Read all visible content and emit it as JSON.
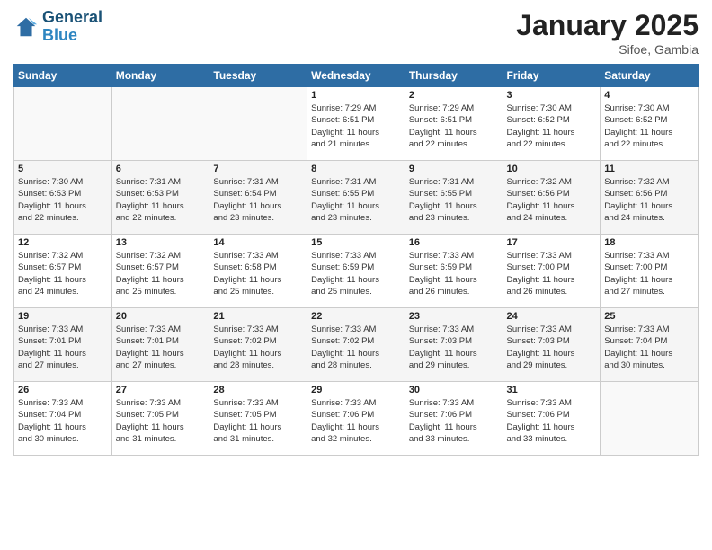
{
  "logo": {
    "line1": "General",
    "line2": "Blue"
  },
  "title": "January 2025",
  "subtitle": "Sifoe, Gambia",
  "weekdays": [
    "Sunday",
    "Monday",
    "Tuesday",
    "Wednesday",
    "Thursday",
    "Friday",
    "Saturday"
  ],
  "weeks": [
    [
      {
        "day": "",
        "info": ""
      },
      {
        "day": "",
        "info": ""
      },
      {
        "day": "",
        "info": ""
      },
      {
        "day": "1",
        "info": "Sunrise: 7:29 AM\nSunset: 6:51 PM\nDaylight: 11 hours\nand 21 minutes."
      },
      {
        "day": "2",
        "info": "Sunrise: 7:29 AM\nSunset: 6:51 PM\nDaylight: 11 hours\nand 22 minutes."
      },
      {
        "day": "3",
        "info": "Sunrise: 7:30 AM\nSunset: 6:52 PM\nDaylight: 11 hours\nand 22 minutes."
      },
      {
        "day": "4",
        "info": "Sunrise: 7:30 AM\nSunset: 6:52 PM\nDaylight: 11 hours\nand 22 minutes."
      }
    ],
    [
      {
        "day": "5",
        "info": "Sunrise: 7:30 AM\nSunset: 6:53 PM\nDaylight: 11 hours\nand 22 minutes."
      },
      {
        "day": "6",
        "info": "Sunrise: 7:31 AM\nSunset: 6:53 PM\nDaylight: 11 hours\nand 22 minutes."
      },
      {
        "day": "7",
        "info": "Sunrise: 7:31 AM\nSunset: 6:54 PM\nDaylight: 11 hours\nand 23 minutes."
      },
      {
        "day": "8",
        "info": "Sunrise: 7:31 AM\nSunset: 6:55 PM\nDaylight: 11 hours\nand 23 minutes."
      },
      {
        "day": "9",
        "info": "Sunrise: 7:31 AM\nSunset: 6:55 PM\nDaylight: 11 hours\nand 23 minutes."
      },
      {
        "day": "10",
        "info": "Sunrise: 7:32 AM\nSunset: 6:56 PM\nDaylight: 11 hours\nand 24 minutes."
      },
      {
        "day": "11",
        "info": "Sunrise: 7:32 AM\nSunset: 6:56 PM\nDaylight: 11 hours\nand 24 minutes."
      }
    ],
    [
      {
        "day": "12",
        "info": "Sunrise: 7:32 AM\nSunset: 6:57 PM\nDaylight: 11 hours\nand 24 minutes."
      },
      {
        "day": "13",
        "info": "Sunrise: 7:32 AM\nSunset: 6:57 PM\nDaylight: 11 hours\nand 25 minutes."
      },
      {
        "day": "14",
        "info": "Sunrise: 7:33 AM\nSunset: 6:58 PM\nDaylight: 11 hours\nand 25 minutes."
      },
      {
        "day": "15",
        "info": "Sunrise: 7:33 AM\nSunset: 6:59 PM\nDaylight: 11 hours\nand 25 minutes."
      },
      {
        "day": "16",
        "info": "Sunrise: 7:33 AM\nSunset: 6:59 PM\nDaylight: 11 hours\nand 26 minutes."
      },
      {
        "day": "17",
        "info": "Sunrise: 7:33 AM\nSunset: 7:00 PM\nDaylight: 11 hours\nand 26 minutes."
      },
      {
        "day": "18",
        "info": "Sunrise: 7:33 AM\nSunset: 7:00 PM\nDaylight: 11 hours\nand 27 minutes."
      }
    ],
    [
      {
        "day": "19",
        "info": "Sunrise: 7:33 AM\nSunset: 7:01 PM\nDaylight: 11 hours\nand 27 minutes."
      },
      {
        "day": "20",
        "info": "Sunrise: 7:33 AM\nSunset: 7:01 PM\nDaylight: 11 hours\nand 27 minutes."
      },
      {
        "day": "21",
        "info": "Sunrise: 7:33 AM\nSunset: 7:02 PM\nDaylight: 11 hours\nand 28 minutes."
      },
      {
        "day": "22",
        "info": "Sunrise: 7:33 AM\nSunset: 7:02 PM\nDaylight: 11 hours\nand 28 minutes."
      },
      {
        "day": "23",
        "info": "Sunrise: 7:33 AM\nSunset: 7:03 PM\nDaylight: 11 hours\nand 29 minutes."
      },
      {
        "day": "24",
        "info": "Sunrise: 7:33 AM\nSunset: 7:03 PM\nDaylight: 11 hours\nand 29 minutes."
      },
      {
        "day": "25",
        "info": "Sunrise: 7:33 AM\nSunset: 7:04 PM\nDaylight: 11 hours\nand 30 minutes."
      }
    ],
    [
      {
        "day": "26",
        "info": "Sunrise: 7:33 AM\nSunset: 7:04 PM\nDaylight: 11 hours\nand 30 minutes."
      },
      {
        "day": "27",
        "info": "Sunrise: 7:33 AM\nSunset: 7:05 PM\nDaylight: 11 hours\nand 31 minutes."
      },
      {
        "day": "28",
        "info": "Sunrise: 7:33 AM\nSunset: 7:05 PM\nDaylight: 11 hours\nand 31 minutes."
      },
      {
        "day": "29",
        "info": "Sunrise: 7:33 AM\nSunset: 7:06 PM\nDaylight: 11 hours\nand 32 minutes."
      },
      {
        "day": "30",
        "info": "Sunrise: 7:33 AM\nSunset: 7:06 PM\nDaylight: 11 hours\nand 33 minutes."
      },
      {
        "day": "31",
        "info": "Sunrise: 7:33 AM\nSunset: 7:06 PM\nDaylight: 11 hours\nand 33 minutes."
      },
      {
        "day": "",
        "info": ""
      }
    ]
  ]
}
